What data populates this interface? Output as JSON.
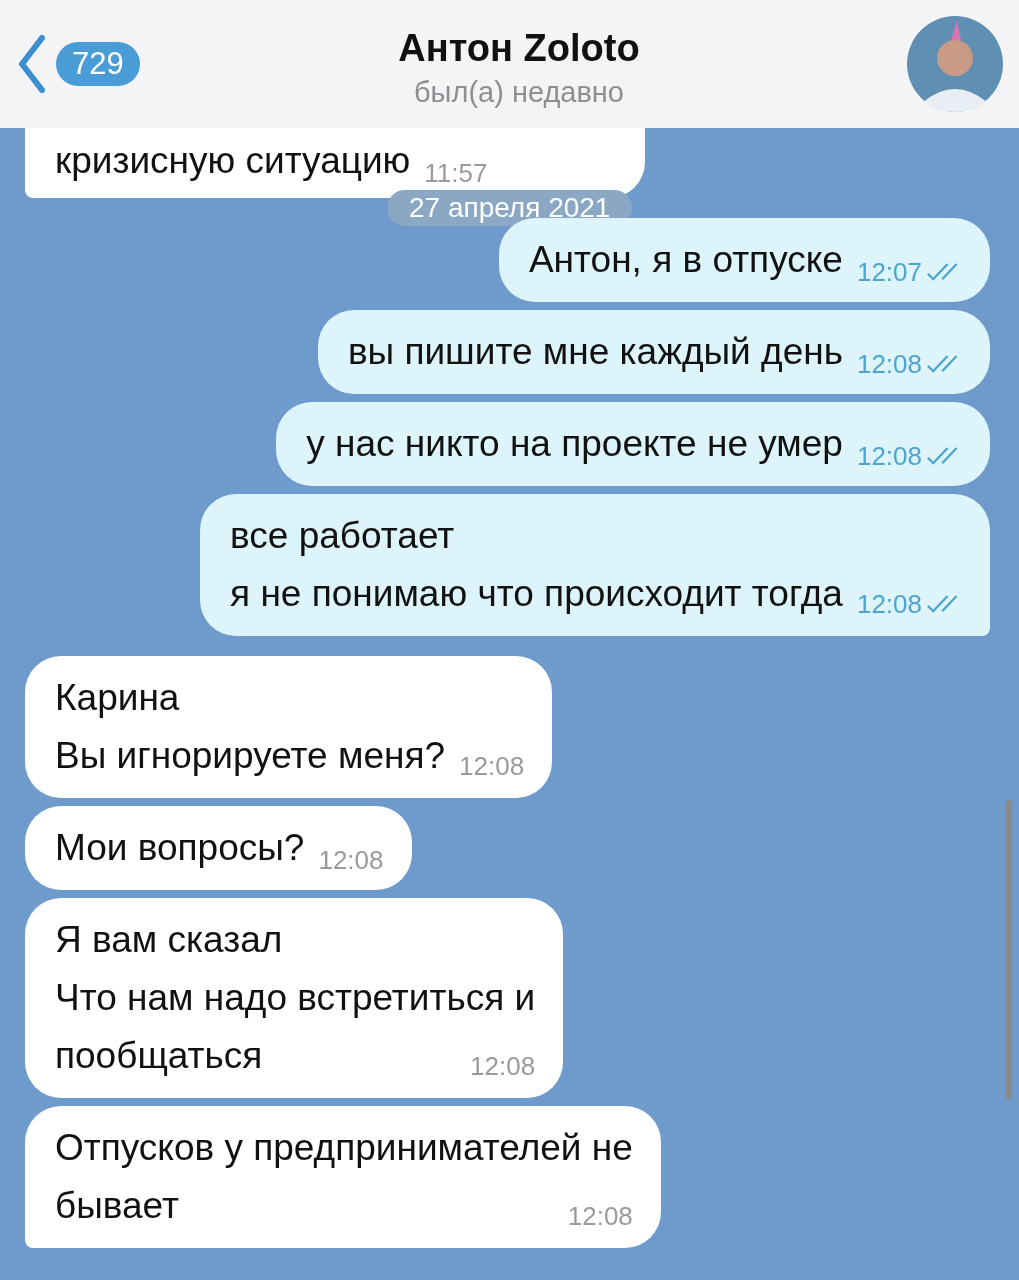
{
  "header": {
    "back_badge": "729",
    "title": "Антон Zoloto",
    "status": "был(а) недавно"
  },
  "date_pill": "27 апреля 2021",
  "messages": [
    {
      "kind": "in",
      "lines": [
        "кризисную ситуацию"
      ],
      "time": "11:57",
      "tail": true
    },
    {
      "kind": "out",
      "lines": [
        "Антон, я в отпуске"
      ],
      "time": "12:07",
      "read": true,
      "tail": false
    },
    {
      "kind": "out",
      "lines": [
        "вы пишите мне каждый день"
      ],
      "time": "12:08",
      "read": true,
      "tail": false
    },
    {
      "kind": "out",
      "lines": [
        "у нас никто на проекте не умер"
      ],
      "time": "12:08",
      "read": true,
      "tail": false
    },
    {
      "kind": "out",
      "lines": [
        "все работает",
        "я не понимаю что происходит тогда"
      ],
      "time": "12:08",
      "read": true,
      "tail": true
    },
    {
      "kind": "in",
      "lines": [
        "Карина",
        "Вы игнорируете меня?"
      ],
      "time": "12:08",
      "tail": false
    },
    {
      "kind": "in",
      "lines": [
        "Мои вопросы?"
      ],
      "time": "12:08",
      "tail": false
    },
    {
      "kind": "in",
      "lines": [
        "Я вам сказал",
        "Что нам надо встретиться и",
        "пообщаться"
      ],
      "time": "12:08",
      "tail": false
    },
    {
      "kind": "in",
      "lines": [
        "Отпусков у предпринимателей не",
        "бывает"
      ],
      "time": "12:08",
      "tail": true
    }
  ]
}
